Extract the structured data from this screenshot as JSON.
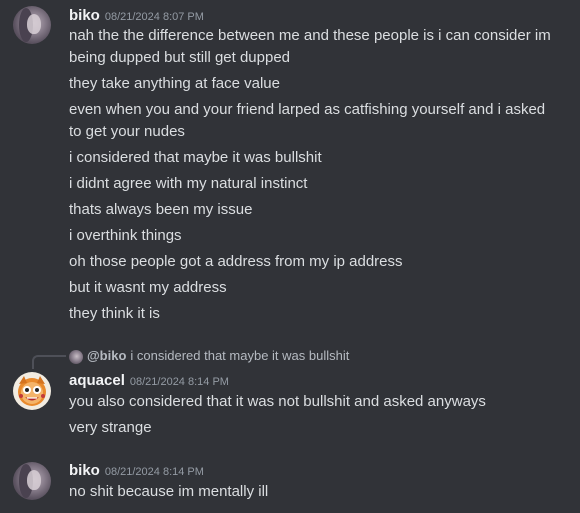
{
  "messages": [
    {
      "username": "biko",
      "timestamp": "08/21/2024 8:07 PM",
      "avatar_icon": "user-avatar-icon",
      "lines": [
        "nah the the difference between me and these people is i can consider im",
        "being dupped but still get dupped",
        "they take anything at face value",
        "even when you and your friend larped as catfishing yourself and i asked",
        "to get your nudes",
        "i considered that maybe it was bullshit",
        "i didnt agree with my natural instinct",
        "thats always been my issue",
        "i overthink things",
        "oh those people got a address from my ip address",
        "but it wasnt my address",
        "they think it is"
      ]
    },
    {
      "username": "aquacel",
      "timestamp": "08/21/2024 8:14 PM",
      "avatar_icon": "cartoon-face-avatar-icon",
      "reply": {
        "mention": "@biko",
        "text": "i considered that maybe it was bullshit"
      },
      "lines": [
        "you also considered that it was not bullshit and asked anyways",
        "very strange"
      ]
    },
    {
      "username": "biko",
      "timestamp": "08/21/2024 8:14 PM",
      "avatar_icon": "user-avatar-icon",
      "lines": [
        "no shit because im mentally ill"
      ]
    }
  ],
  "colors": {
    "background": "#313338",
    "username": "#f2f3f5",
    "text": "#dbdee1",
    "timestamp": "#949ba4",
    "reply_spine": "#4e5058"
  }
}
